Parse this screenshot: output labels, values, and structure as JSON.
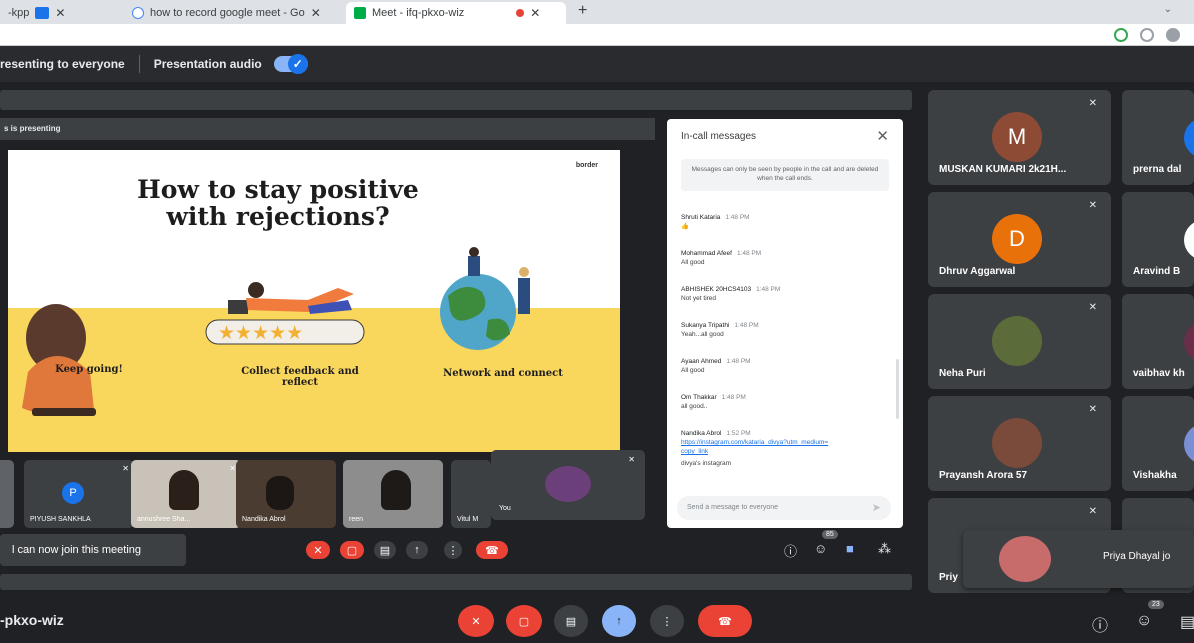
{
  "browser": {
    "tabs": [
      {
        "label": "-kpp",
        "close": "✕"
      },
      {
        "label": "how to record google meet - Go",
        "close": "✕"
      },
      {
        "label": "Meet - ifq-pkxo-wiz",
        "close": "✕"
      }
    ],
    "new_tab": "+"
  },
  "present_bar": {
    "presenting_to": "resenting to everyone",
    "audio_label": "Presentation audio"
  },
  "presenting_label": "s is presenting",
  "slide": {
    "title_line1": "How to stay positive",
    "title_line2": "with rejections?",
    "logo": "border",
    "captions": [
      "Keep going!",
      "Collect feedback and reflect",
      "Network and connect"
    ]
  },
  "chat": {
    "header": "In-call messages",
    "close": "✕",
    "notice": "Messages can only be seen by people in the call and are deleted when the call ends.",
    "messages": [
      {
        "who": "Shruti Kataria",
        "time": "1:48 PM",
        "text": "👍"
      },
      {
        "who": "Mohammad Afeef",
        "time": "1:48 PM",
        "text": "All good"
      },
      {
        "who": "ABHISHEK 20HCS4103",
        "time": "1:48 PM",
        "text": "Not yet tired"
      },
      {
        "who": "Sukanya Tripathi",
        "time": "1:48 PM",
        "text": "Yeah...all good"
      },
      {
        "who": "Ayaan Ahmed",
        "time": "1:48 PM",
        "text": "All good"
      },
      {
        "who": "Om Thakkar",
        "time": "1:48 PM",
        "text": "all good.."
      },
      {
        "who": "Nandika Abrol",
        "time": "1:52 PM",
        "link": "https://instagram.com/kataria_divya?utm_medium=copy_link",
        "text": "divya's instagram"
      }
    ],
    "input_placeholder": "Send a message to everyone"
  },
  "filmstrip": [
    {
      "name": "PIYUSH SANKHLA",
      "initial": "P",
      "color": "#1a73e8"
    },
    {
      "name": "annushree Sha..."
    },
    {
      "name": "Nandika Abrol"
    },
    {
      "name": "reen"
    },
    {
      "name": "Vitul M"
    }
  ],
  "you_tile": "You",
  "toast": "l can now join this meeting",
  "inner_controls": {
    "people_count": "85"
  },
  "bottom": {
    "meeting_code": "-pkxo-wiz",
    "people_count": "23"
  },
  "participants": [
    {
      "name": "MUSKAN KUMARI 2k21H...",
      "initial": "M",
      "color": "#8d4b35"
    },
    {
      "name": "prerna dal"
    },
    {
      "name": "Dhruv Aggarwal",
      "initial": "D",
      "color": "#e8710a"
    },
    {
      "name": "Aravind B"
    },
    {
      "name": "Neha Puri"
    },
    {
      "name": "vaibhav kh"
    },
    {
      "name": "Prayansh Arora 57"
    },
    {
      "name": "Vishakha"
    },
    {
      "name": "Priy"
    }
  ],
  "overlay_participant": "Priya Dhayal jo"
}
